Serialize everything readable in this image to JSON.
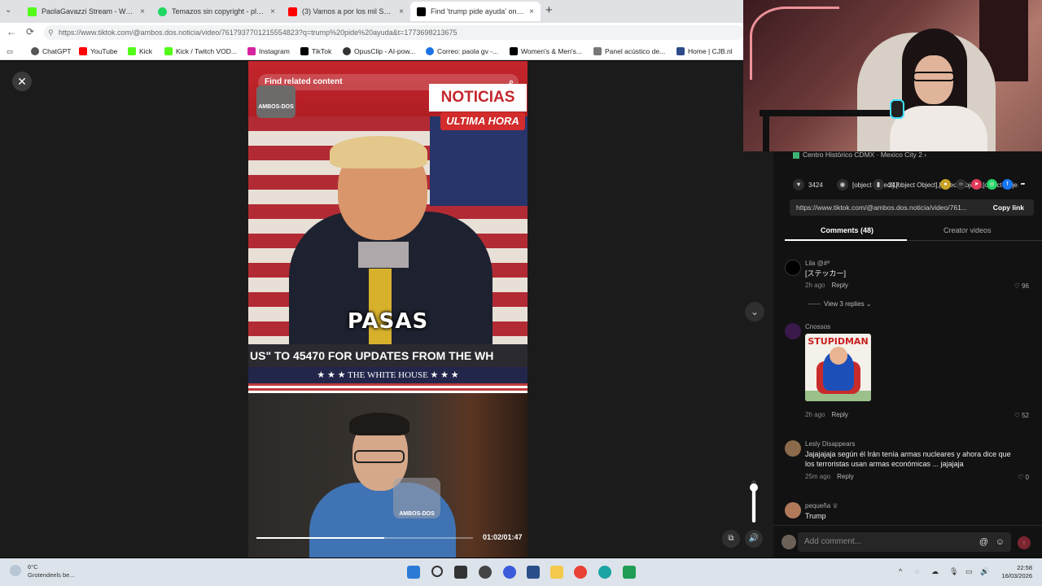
{
  "browser": {
    "tabs": [
      {
        "title": "PaolaGavazzi Stream - Watch Live",
        "favicon_color": "#53fc18",
        "close": "×"
      },
      {
        "title": "Temazos sin copyright - playlist b",
        "favicon_color": "#1ed760",
        "close": "×"
      },
      {
        "title": "(3) Vamos a por los mil SEGUIDORES",
        "favicon_color": "#ff0000",
        "close": "×"
      },
      {
        "title": "Find 'trump pide ayuda' on TikTok",
        "favicon_color": "#000000",
        "close": "×"
      }
    ],
    "tab_menu": "⌄",
    "new_tab": "+",
    "nav": {
      "back": "←",
      "reload": "⟳"
    },
    "url": "https://www.tiktok.com/@ambos.dos.noticia/video/7617937701215554823?q=trump%20pide%20ayuda&t=1773698213675",
    "bookmarks": [
      {
        "label": "ChatGPT",
        "color": "#555555"
      },
      {
        "label": "YouTube",
        "color": "#ff0000"
      },
      {
        "label": "Kick",
        "color": "#53fc18"
      },
      {
        "label": "Kick / Twitch VOD...",
        "color": "#53fc18"
      },
      {
        "label": "Instagram",
        "color": "#d6249f"
      },
      {
        "label": "TikTok",
        "color": "#000000"
      },
      {
        "label": "OpusClip - AI-pow...",
        "color": "#333333"
      },
      {
        "label": "Correo: paola gv -...",
        "color": "#1a73e8"
      },
      {
        "label": "Women's & Men's...",
        "color": "#000000"
      },
      {
        "label": "Panel acústico de...",
        "color": "#777777"
      },
      {
        "label": "Home | CJB.nl",
        "color": "#2d4a8a"
      }
    ]
  },
  "video": {
    "close": "✕",
    "search_placeholder": "Find related content",
    "search_icon": "⌕",
    "badge_top": "AMBOS-DOS",
    "noticias": "NOTICIAS",
    "ultima_hora": "ULTIMA HORA",
    "caption": "PASAS",
    "ticker": "US\" TO 45470 FOR UPDATES FROM THE WH",
    "white_house": "★ ★ ★   THE WHITE HOUSE   ★ ★ ★",
    "badge_bottom": "AMBOS-DOS",
    "time": "01:02/01:47",
    "progress": 0.59,
    "volume": 0.82,
    "scroll_down": "⌄",
    "pip_icon": "⧉",
    "volume_icon": "🔊"
  },
  "panel": {
    "location": "Centro Histórico CDMX · Mexico City",
    "location_extra": "2 ›",
    "likes": "3424",
    "comments": [
      {
        "name": "Lila @#º",
        "text": "[ステッカー]",
        "time": "2h ago",
        "reply": "Reply",
        "likes": "96",
        "replies": "View 3 replies",
        "avatar_color": "#000000"
      },
      {
        "name": "Cnossos",
        "sticker_text": "STUPIDMAN",
        "time": "2h ago",
        "reply": "Reply",
        "likes": "52",
        "avatar_color": "#3a1a4a"
      },
      {
        "name": "Lesly Disappears",
        "text": "Jajajajaja según él Irán tenía armas nucleares y ahora dice que los terroristas usan armas económicas ... jajajaja",
        "time": "25m ago",
        "reply": "Reply",
        "likes": "0",
        "avatar_color": "#8a6a4a"
      },
      {
        "name": "pequeña ♕",
        "text": "Trump",
        "avatar_color": "#b07a5a"
      }
    ],
    "saves": "247",
    "share_icons": [
      {
        "name": "coin",
        "color": "#c9a227",
        "glyph": "●"
      },
      {
        "name": "embed",
        "color": "#2d2d2d",
        "glyph": "‹›"
      },
      {
        "name": "send",
        "color": "#e03a5a",
        "glyph": "➤"
      },
      {
        "name": "whatsapp",
        "color": "#25d366",
        "glyph": "◎"
      },
      {
        "name": "facebook",
        "color": "#1877f2",
        "glyph": "f"
      },
      {
        "name": "share",
        "color": "#121212",
        "glyph": "➦"
      }
    ],
    "share_url": "https://www.tiktok.com/@ambos.dos.noticia/video/761...",
    "copy_label": "Copy link",
    "tab_comments": "Comments (48)",
    "tab_creator": "Creator videos",
    "add_comment_placeholder": "Add comment...",
    "at_icon": "@",
    "emoji_icon": "☺",
    "send_icon": "↑",
    "heart_icon": "♡"
  },
  "taskbar": {
    "temp": "6°C",
    "weather_text": "Grotendeels be...",
    "time": "22:58",
    "date": "16/03/2026",
    "tray_icons": [
      "^",
      "◌",
      "☁",
      "🎙",
      "▭",
      "🔊",
      "🔋"
    ]
  }
}
